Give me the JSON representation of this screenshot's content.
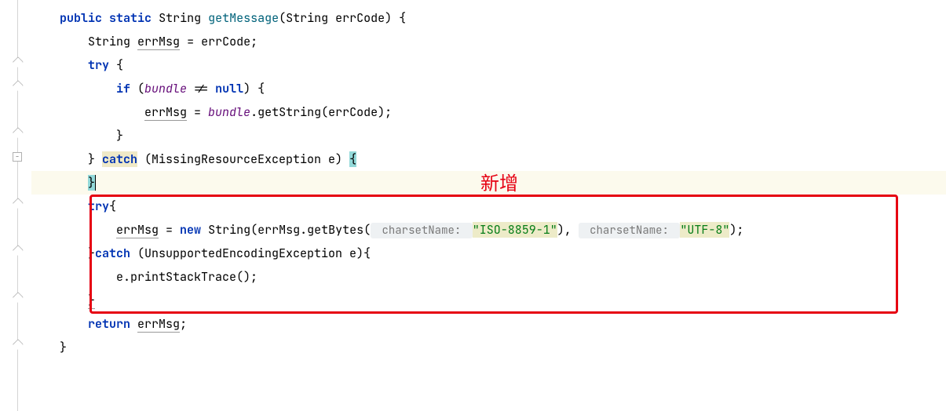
{
  "code": {
    "l1": {
      "kw1": "public",
      "kw2": "static",
      "type": "String",
      "method": "getMessage",
      "paramType": "String",
      "paramName": "errCode",
      "tail": ") {"
    },
    "l2": {
      "type": "String",
      "var": "errMsg",
      "rest": " = errCode;"
    },
    "l3": {
      "kw": "try",
      "rest": " {"
    },
    "l4": {
      "kw": "if",
      "open": " (",
      "bundle": "bundle",
      "rest": " != ",
      "nullkw": "null",
      "close": ") {"
    },
    "l5": {
      "var": "errMsg",
      "eq": " = ",
      "bundle": "bundle",
      "call": ".getString(errCode);"
    },
    "l6": {
      "text": "}"
    },
    "l7": {
      "close": "} ",
      "catch": "catch",
      "open": " (MissingResourceException e) ",
      "brace": "{"
    },
    "l8": {
      "brace": "}"
    },
    "l9": {
      "kw": "try",
      "brace": "{"
    },
    "l10": {
      "var": "errMsg",
      "eq": " = ",
      "new": "new",
      "sp": " String(errMsg.getBytes(",
      "hint1": " charsetName: ",
      "str1": "\"ISO-8859-1\"",
      "mid": "),",
      "hint2": " charsetName: ",
      "str2": "\"UTF-8\"",
      "tail": ");"
    },
    "l11": {
      "close": "}",
      "catch": "catch",
      "rest": " (UnsupportedEncodingException e){"
    },
    "l12": {
      "text": "e.printStackTrace();"
    },
    "l13": {
      "text": "}"
    },
    "l14": {
      "kw": "return",
      "sp": " ",
      "var": "errMsg",
      "semi": ";"
    },
    "l15": {
      "text": "}"
    }
  },
  "annotation": {
    "label": "新增"
  }
}
